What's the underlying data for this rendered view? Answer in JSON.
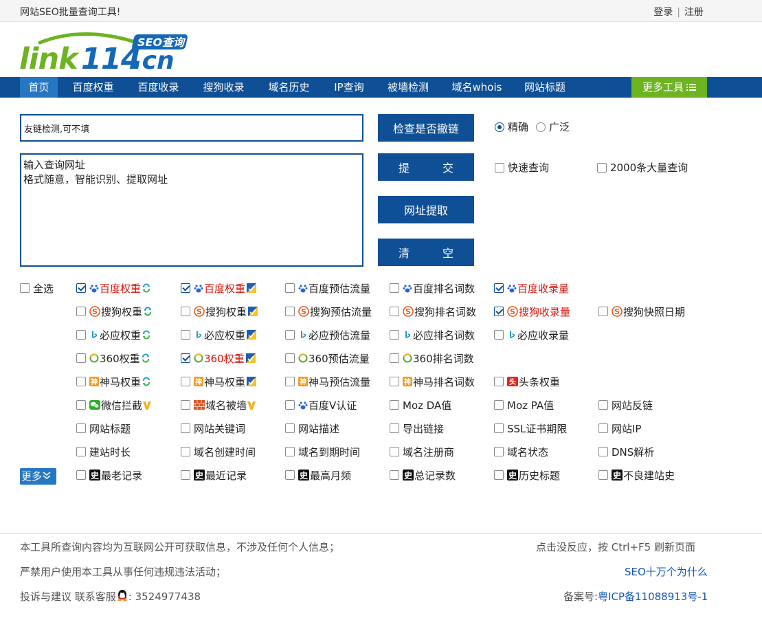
{
  "topbar": {
    "tagline": "网站SEO批量查询工具!",
    "login": "登录",
    "register": "注册",
    "sep": "|"
  },
  "logo": {
    "text": "link114.cn",
    "badge": "SEO查询"
  },
  "nav": {
    "items": [
      "首页",
      "百度权重",
      "百度收录",
      "搜狗收录",
      "域名历史",
      "IP查询",
      "被墙检测",
      "域名whois",
      "网站标题"
    ],
    "more": "更多工具"
  },
  "form": {
    "keyword_value": "友链检测,可不填",
    "url_placeholder": "输入查询网址\n格式随意，智能识别、提取网址",
    "check_button": "检查是否撤链",
    "submit_button": "提　　　交",
    "extract_button": "网址提取",
    "clear_button": "清　　　空",
    "match_exact": "精确",
    "match_broad": "广泛",
    "fast_query": "快速查询",
    "bulk_query": "2000条大量查询"
  },
  "options": {
    "select_all": "全选",
    "more": "更多",
    "rows": [
      [
        {
          "label": "百度权重",
          "icon": "baidu",
          "badge": "refresh",
          "checked": true,
          "red": true
        },
        {
          "label": "百度权重",
          "icon": "baidu",
          "badge": "shield",
          "checked": true,
          "red": true
        },
        {
          "label": "百度预估流量",
          "icon": "baidu",
          "checked": false
        },
        {
          "label": "百度排名词数",
          "icon": "baidu",
          "checked": false
        },
        {
          "label": "百度收录量",
          "icon": "baidu",
          "checked": true,
          "red": true
        }
      ],
      [
        {
          "label": "搜狗权重",
          "icon": "sogou",
          "badge": "refresh",
          "checked": false
        },
        {
          "label": "搜狗权重",
          "icon": "sogou",
          "badge": "shield",
          "checked": false
        },
        {
          "label": "搜狗预估流量",
          "icon": "sogou",
          "checked": false
        },
        {
          "label": "搜狗排名词数",
          "icon": "sogou",
          "checked": false
        },
        {
          "label": "搜狗收录量",
          "icon": "sogou",
          "checked": true,
          "red": true
        },
        {
          "label": "搜狗快照日期",
          "icon": "sogou",
          "checked": false
        }
      ],
      [
        {
          "label": "必应权重",
          "icon": "bing",
          "badge": "refresh",
          "checked": false
        },
        {
          "label": "必应权重",
          "icon": "bing",
          "badge": "shield",
          "checked": false
        },
        {
          "label": "必应预估流量",
          "icon": "bing",
          "checked": false
        },
        {
          "label": "必应排名词数",
          "icon": "bing",
          "checked": false
        },
        {
          "label": "必应收录量",
          "icon": "bing",
          "checked": false
        }
      ],
      [
        {
          "label": "360权重",
          "icon": "360",
          "badge": "refresh",
          "checked": false
        },
        {
          "label": "360权重",
          "icon": "360",
          "badge": "shield",
          "checked": true,
          "red": true
        },
        {
          "label": "360预估流量",
          "icon": "360",
          "checked": false
        },
        {
          "label": "360排名词数",
          "icon": "360",
          "checked": false
        }
      ],
      [
        {
          "label": "神马权重",
          "icon": "shenma",
          "badge": "refresh",
          "checked": false
        },
        {
          "label": "神马权重",
          "icon": "shenma",
          "badge": "shield",
          "checked": false
        },
        {
          "label": "神马预估流量",
          "icon": "shenma",
          "checked": false
        },
        {
          "label": "神马排名词数",
          "icon": "shenma",
          "checked": false
        },
        {
          "label": "头条权重",
          "icon": "toutiao",
          "checked": false
        }
      ],
      [
        {
          "label": "微信拦截",
          "icon": "wechat",
          "badge": "v",
          "checked": false
        },
        {
          "label": "域名被墙",
          "icon": "wall",
          "badge": "v",
          "checked": false
        },
        {
          "label": "百度V认证",
          "icon": "baidu",
          "checked": false
        },
        {
          "label": "Moz DA值",
          "checked": false
        },
        {
          "label": "Moz PA值",
          "checked": false
        },
        {
          "label": "网站反链",
          "checked": false
        }
      ],
      [
        {
          "label": "网站标题",
          "checked": false
        },
        {
          "label": "网站关键词",
          "checked": false
        },
        {
          "label": "网站描述",
          "checked": false
        },
        {
          "label": "导出链接",
          "checked": false
        },
        {
          "label": "SSL证书期限",
          "checked": false
        },
        {
          "label": "网站IP",
          "checked": false
        }
      ],
      [
        {
          "label": "建站时长",
          "checked": false
        },
        {
          "label": "域名创建时间",
          "checked": false
        },
        {
          "label": "域名到期时间",
          "checked": false
        },
        {
          "label": "域名注册商",
          "checked": false
        },
        {
          "label": "域名状态",
          "checked": false
        },
        {
          "label": "DNS解析",
          "checked": false
        }
      ],
      [
        {
          "label": "最老记录",
          "icon": "history",
          "checked": false
        },
        {
          "label": "最近记录",
          "icon": "history",
          "checked": false
        },
        {
          "label": "最高月频",
          "icon": "history",
          "checked": false
        },
        {
          "label": "总记录数",
          "icon": "history",
          "checked": false
        },
        {
          "label": "历史标题",
          "icon": "history",
          "checked": false
        },
        {
          "label": "不良建站史",
          "icon": "history",
          "checked": false
        }
      ]
    ]
  },
  "footer": {
    "notice1": "本工具所查询内容均为互联网公开可获取信息，不涉及任何个人信息；",
    "notice2": "严禁用户使用本工具从事任何违规违法活动；",
    "contact_prefix": "投诉与建议 联系客服",
    "contact_qq": ": 3524977438",
    "refresh_tip": "点击没反应，按 Ctrl+F5 刷新页面",
    "seo_link": "SEO十万个为什么",
    "icp_prefix": "备案号:",
    "icp_link": "粤ICP备11088913号-1"
  },
  "colors": {
    "brand_blue": "#0e4f95",
    "nav_active": "#2676c2",
    "more_green": "#6cb420",
    "logo_green": "#6cb420",
    "logo_blue": "#1468b8",
    "checked_red": "#d8150b"
  }
}
